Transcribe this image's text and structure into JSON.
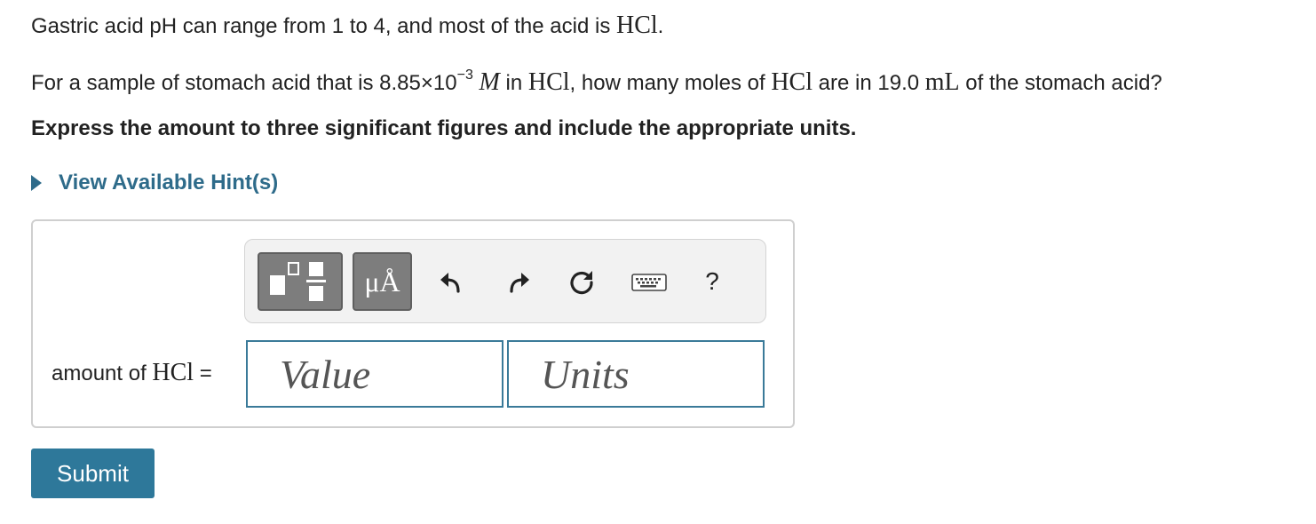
{
  "question": {
    "intro_text": "Gastric acid pH can range from 1 to 4, and most of the acid is ",
    "intro_formula": "HCl",
    "intro_end": ".",
    "prompt_part1": "For a sample of stomach acid that is 8.85×10",
    "prompt_exponent": "−3",
    "prompt_molar": "M",
    "prompt_part2": " in ",
    "prompt_formula1": "HCl",
    "prompt_part3": ", how many moles of ",
    "prompt_formula2": "HCl",
    "prompt_part4": " are in 19.0 ",
    "prompt_unit": "mL",
    "prompt_part5": " of the stomach acid?",
    "instruction": "Express the amount to three significant figures and include the appropriate units."
  },
  "hint": {
    "label": "View Available Hint(s)"
  },
  "toolbar": {
    "templates_icon": "templates-icon",
    "units_label": "μÅ",
    "undo_icon": "undo-icon",
    "redo_icon": "redo-icon",
    "reset_icon": "reset-icon",
    "keyboard_icon": "keyboard-icon",
    "help_label": "?"
  },
  "answer": {
    "label_prefix": "amount of ",
    "label_formula": "HCl",
    "label_equals": " =",
    "value_placeholder": "Value",
    "units_placeholder": "Units"
  },
  "submit": {
    "label": "Submit"
  },
  "colors": {
    "link": "#2e6b8a",
    "submit_bg": "#2e789a",
    "field_border": "#3a7a99",
    "toolbar_button": "#7d7d7d"
  }
}
